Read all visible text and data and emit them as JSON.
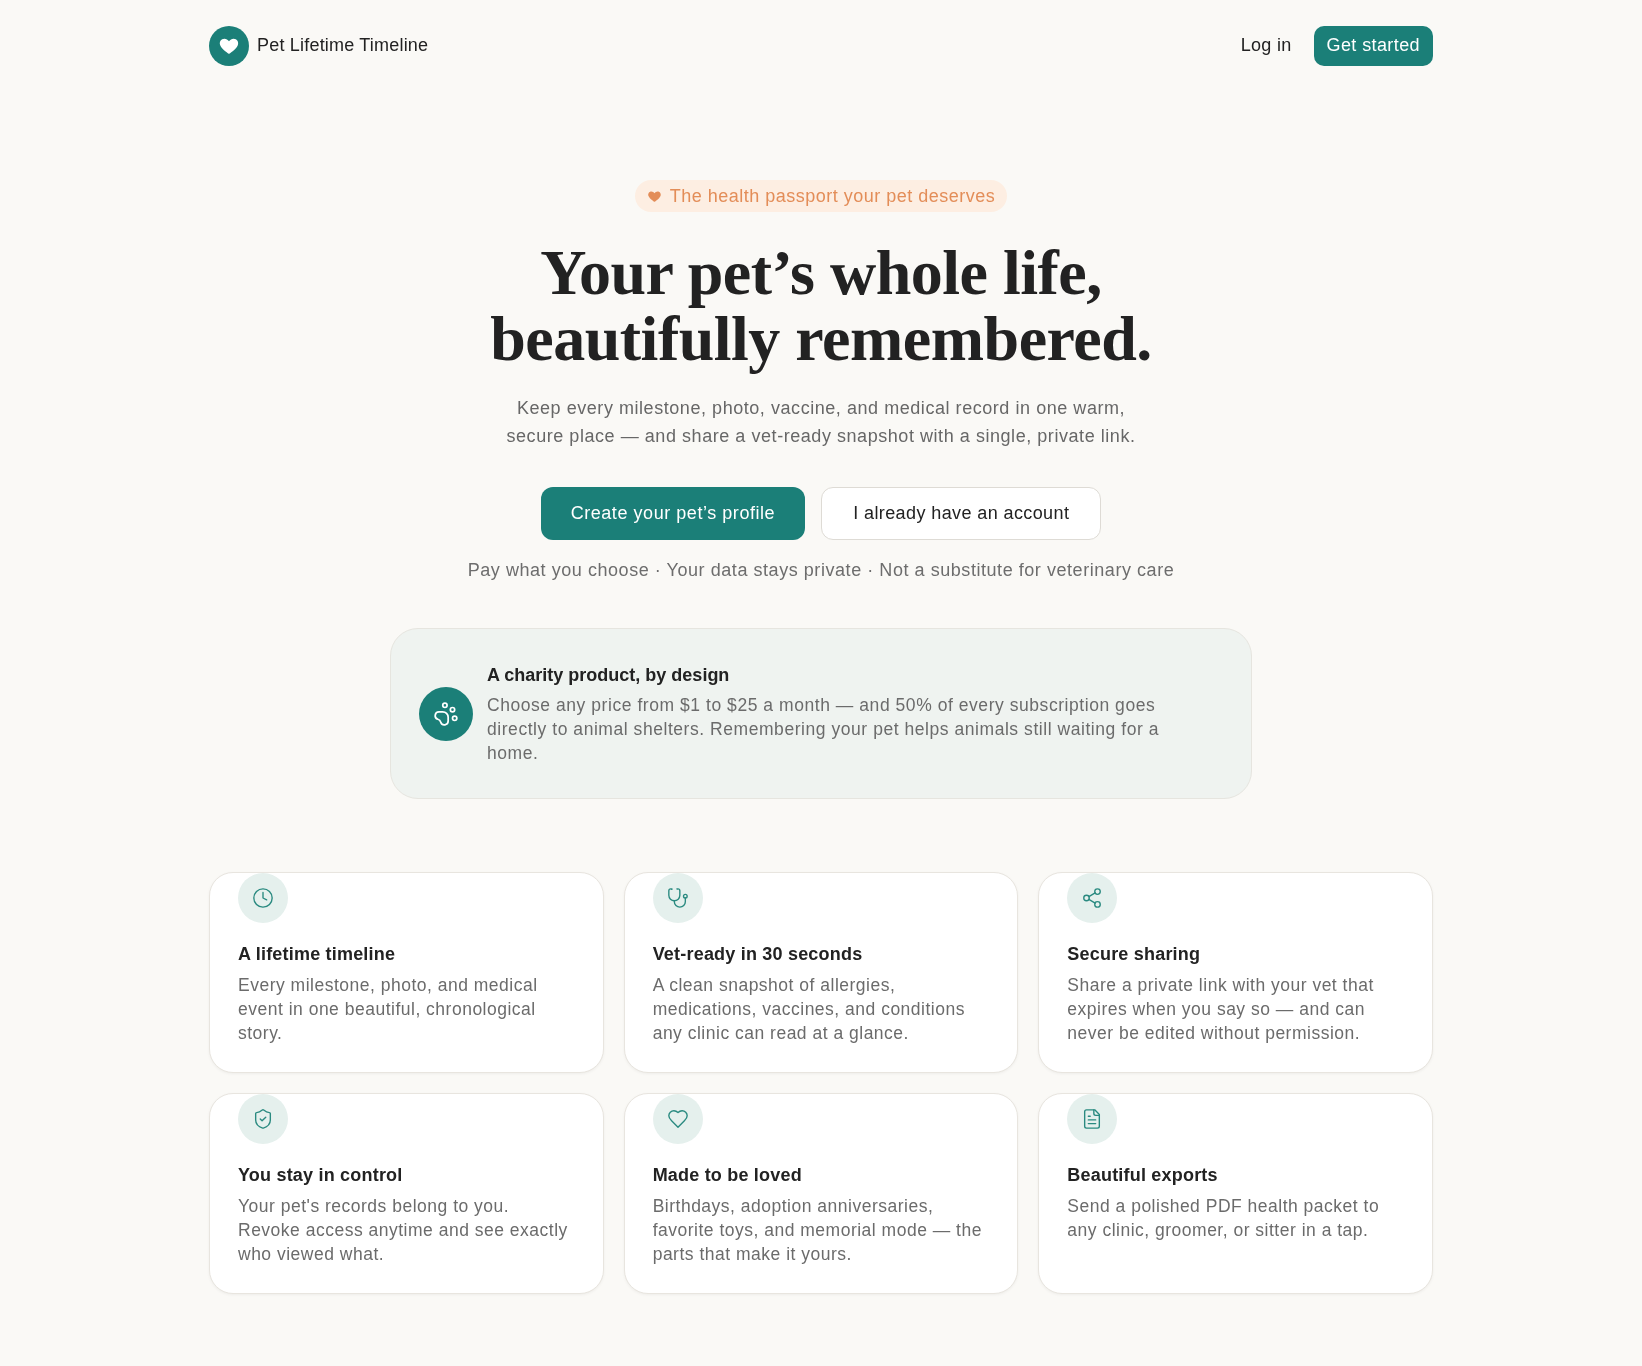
{
  "header": {
    "brand": "Pet Lifetime Timeline",
    "nav": [
      {
        "label": "Log in",
        "kind": "link"
      },
      {
        "label": "Get started",
        "kind": "button"
      }
    ]
  },
  "hero": {
    "badge": "The health passport your pet deserves",
    "title_lines": [
      "Your pet’s whole life,",
      "beautifully remembered."
    ],
    "subtitle": "Keep every milestone, photo, vaccine, and medical record in one warm, secure place — and share a vet-ready snapshot with a single, private link.",
    "actions": [
      {
        "label": "Create your pet’s profile",
        "kind": "primary"
      },
      {
        "label": "I already have an account",
        "kind": "secondary"
      }
    ],
    "note": "Pay what you choose · Your data stays private · Not a substitute for veterinary care"
  },
  "charity": {
    "title": "A charity product, by design",
    "text": "Choose any price from $1 to $25 a month — and 50% of every subscription goes directly to animal shelters. Remembering your pet helps animals still waiting for a home."
  },
  "features": [
    {
      "kind": "clock",
      "title": "A lifetime timeline",
      "text": "Every milestone, photo, and medical event in one beautiful, chronological story."
    },
    {
      "kind": "stethoscope",
      "title": "Vet-ready in 30 seconds",
      "text": "A clean snapshot of allergies, medications, vaccines, and conditions any clinic can read at a glance."
    },
    {
      "kind": "share",
      "title": "Secure sharing",
      "text": "Share a private link with your vet that expires when you say so — and can never be edited without permission."
    },
    {
      "kind": "shield",
      "title": "You stay in control",
      "text": "Your pet's records belong to you. Revoke access anytime and see exactly who viewed what."
    },
    {
      "kind": "heart",
      "title": "Made to be loved",
      "text": "Birthdays, adoption anniversaries, favorite toys, and memorial mode — the parts that make it yours."
    },
    {
      "kind": "document",
      "title": "Beautiful exports",
      "text": "Send a polished PDF health packet to any clinic, groomer, or sitter in a tap."
    }
  ]
}
